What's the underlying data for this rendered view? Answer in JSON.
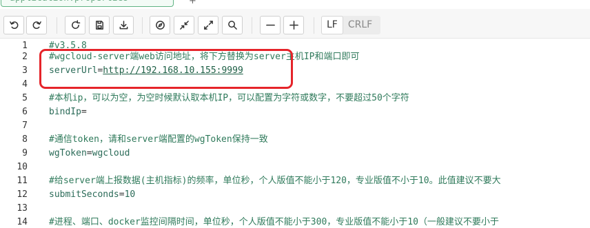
{
  "tab": {
    "filename": "application.properties",
    "plus": "+"
  },
  "toolbar": {
    "buttons": [
      {
        "name": "undo",
        "icon": "undo-icon"
      },
      {
        "name": "redo",
        "icon": "redo-icon"
      },
      {
        "name": "refresh",
        "icon": "refresh-icon"
      },
      {
        "name": "save",
        "icon": "save-icon"
      },
      {
        "name": "download",
        "icon": "download-icon"
      },
      {
        "name": "compass",
        "icon": "compass-icon"
      },
      {
        "name": "collapse",
        "icon": "collapse-icon"
      },
      {
        "name": "expand",
        "icon": "expand-icon"
      },
      {
        "name": "search",
        "icon": "search-icon"
      },
      {
        "name": "zoom-out",
        "icon": "minus-icon"
      },
      {
        "name": "zoom-in",
        "icon": "plus-icon"
      }
    ],
    "eol": {
      "lf": "LF",
      "crlf": "CRLF",
      "selected": "LF"
    }
  },
  "editor": {
    "lines": [
      {
        "num": "1",
        "type": "comment",
        "text": "#v3.5.8"
      },
      {
        "num": "2",
        "type": "comment",
        "text": "#wgcloud-server端web访问地址，将下方替换为server主机IP和端口即可"
      },
      {
        "num": "3",
        "type": "kv-link",
        "key": "serverUrl",
        "op": "=",
        "value": "http://192.168.10.155:9999"
      },
      {
        "num": "4",
        "type": "blank",
        "text": ""
      },
      {
        "num": "5",
        "type": "comment",
        "text": "#本机ip，可以为空，为空时候默认取本机IP，可以配置为字符或数字，不要超过50个字符"
      },
      {
        "num": "6",
        "type": "kv",
        "key": "bindIp",
        "op": "=",
        "value": ""
      },
      {
        "num": "7",
        "type": "blank",
        "text": ""
      },
      {
        "num": "8",
        "type": "comment",
        "text": "#通信token，请和server端配置的wgToken保持一致"
      },
      {
        "num": "9",
        "type": "kv",
        "key": "wgToken",
        "op": "=",
        "value": "wgcloud"
      },
      {
        "num": "10",
        "type": "blank",
        "text": ""
      },
      {
        "num": "11",
        "type": "comment",
        "text": "#给server端上报数据(主机指标)的频率，单位秒，个人版值不能小于120，专业版值不小于10。此值建议不要大"
      },
      {
        "num": "12",
        "type": "kv",
        "key": "submitSeconds",
        "op": "=",
        "value": "10"
      },
      {
        "num": "13",
        "type": "blank",
        "text": ""
      },
      {
        "num": "14",
        "type": "comment",
        "text": "#进程、端口、docker监控间隔时间，单位秒，个人版值不能小于300，专业版值不能小于10（一般建议不要小于"
      }
    ]
  },
  "colors": {
    "comment": "#2f7a5b",
    "highlight": "#e5242a",
    "tab_border": "#5fb383"
  }
}
